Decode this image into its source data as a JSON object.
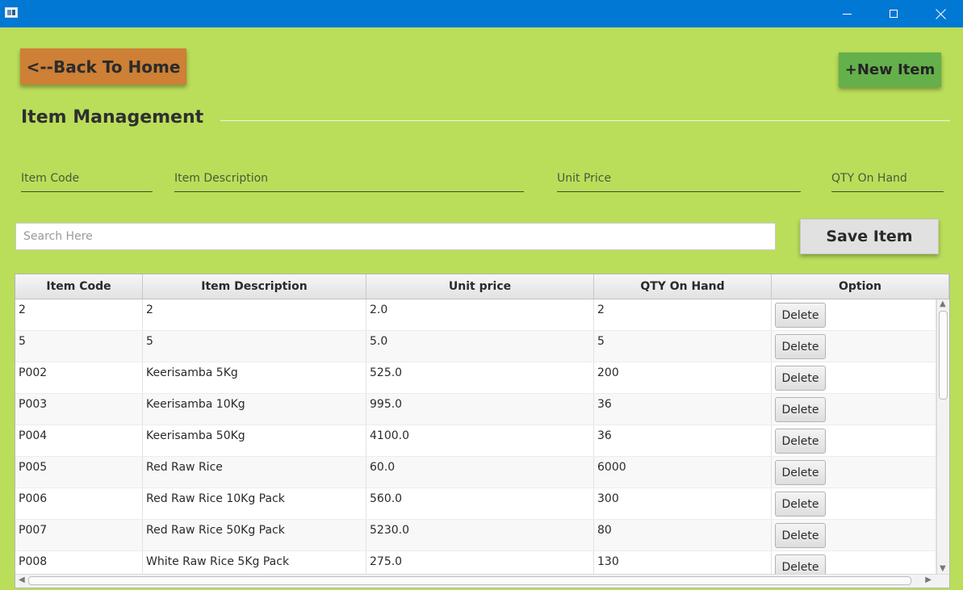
{
  "window": {
    "icon": "app-window-icon",
    "controls": {
      "minimize_icon": "minimize-icon",
      "maximize_icon": "maximize-icon",
      "close_icon": "close-icon"
    }
  },
  "header": {
    "back_label": "<--Back To Home",
    "new_item_label": "+New Item",
    "title": "Item Management"
  },
  "form": {
    "item_code_label": "Item Code",
    "item_description_label": "Item Description",
    "unit_price_label": "Unit Price",
    "qty_on_hand_label": "QTY On Hand"
  },
  "search": {
    "placeholder": "Search Here",
    "value": ""
  },
  "save_label": "Save Item",
  "table": {
    "columns": [
      "Item Code",
      "Item Description",
      "Unit price",
      "QTY On Hand",
      "Option"
    ],
    "delete_label": "Delete",
    "rows": [
      [
        "2",
        "2",
        "2.0",
        "2"
      ],
      [
        "5",
        "5",
        "5.0",
        "5"
      ],
      [
        "P002",
        "Keerisamba 5Kg",
        "525.0",
        "200"
      ],
      [
        "P003",
        "Keerisamba 10Kg",
        "995.0",
        "36"
      ],
      [
        "P004",
        "Keerisamba 50Kg",
        "4100.0",
        "36"
      ],
      [
        "P005",
        "Red Raw Rice",
        "60.0",
        "6000"
      ],
      [
        "P006",
        "Red Raw Rice 10Kg Pack",
        "560.0",
        "300"
      ],
      [
        "P007",
        "Red Raw Rice 50Kg Pack",
        "5230.0",
        "80"
      ],
      [
        "P008",
        "White Raw Rice 5Kg Pack",
        "275.0",
        "130"
      ]
    ]
  },
  "colors": {
    "background": "#bade5a",
    "titlebar": "#0078d4",
    "back_button": "#cd8036",
    "new_item_button": "#64b04b",
    "save_button": "#e1e1e1"
  }
}
